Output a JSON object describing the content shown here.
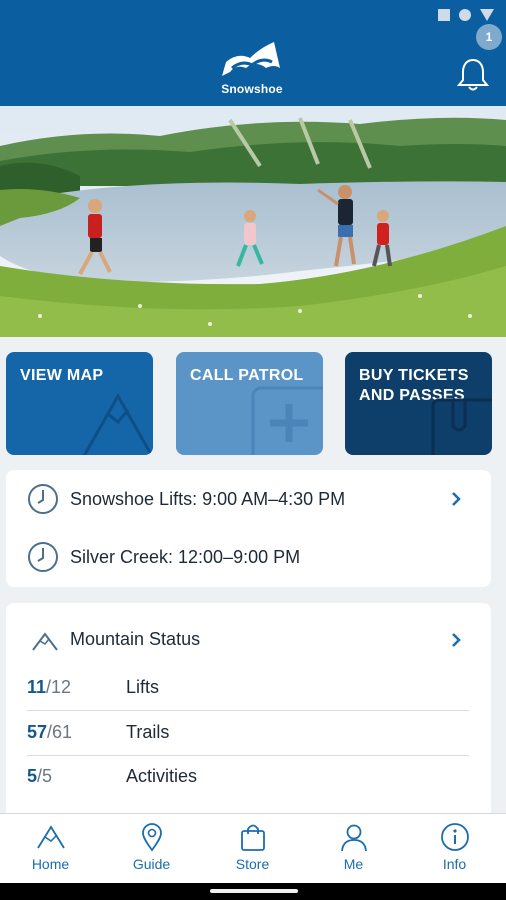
{
  "header": {
    "brand_name": "Snowshoe",
    "notification_count": "1"
  },
  "tiles": [
    {
      "label": "VIEW MAP"
    },
    {
      "label": "CALL PATROL"
    },
    {
      "label": "BUY TICKETS AND PASSES"
    }
  ],
  "hours": [
    {
      "text": "Snowshoe Lifts: 9:00 AM–4:30 PM"
    },
    {
      "text": "Silver Creek: 12:00–9:00 PM"
    }
  ],
  "mountain_status": {
    "title": "Mountain Status",
    "rows": [
      {
        "open": "11",
        "total": "/12",
        "label": "Lifts"
      },
      {
        "open": "57",
        "total": "/61",
        "label": "Trails"
      },
      {
        "open": "5",
        "total": "/5",
        "label": "Activities"
      }
    ]
  },
  "tabs": [
    {
      "label": "Home"
    },
    {
      "label": "Guide"
    },
    {
      "label": "Store"
    },
    {
      "label": "Me"
    },
    {
      "label": "Info"
    }
  ],
  "colors": {
    "brand_blue": "#0b5ea0",
    "accent_blue": "#1a6db0",
    "tile_map": "#1566a8",
    "tile_patrol": "#5b95c8",
    "tile_tickets": "#0e3e6a"
  }
}
